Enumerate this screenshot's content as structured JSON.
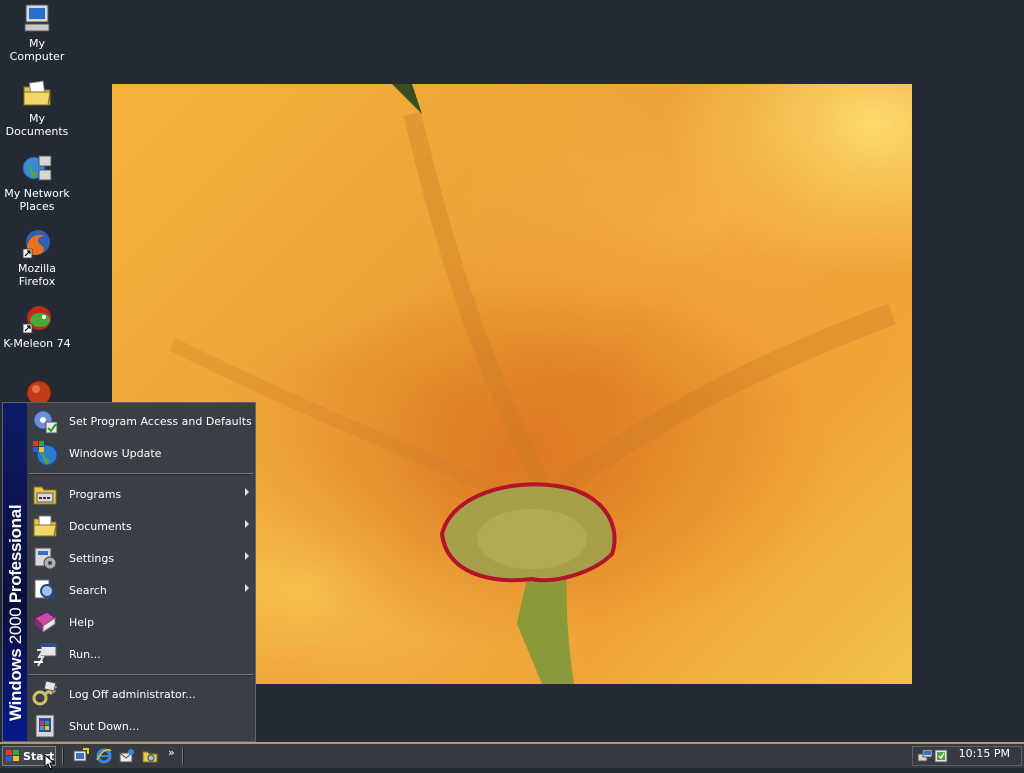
{
  "desktop": {
    "icons": [
      {
        "label": "My Computer"
      },
      {
        "label": "My Documents"
      },
      {
        "label": "My Network Places"
      },
      {
        "label": "Mozilla Firefox"
      },
      {
        "label": "K-Meleon 74"
      }
    ]
  },
  "start_menu": {
    "band_bold": "Windows",
    "band_thin": "2000",
    "band_edition": "Professional",
    "items": [
      {
        "label": "Set Program Access and Defaults",
        "icon": "program-access-icon"
      },
      {
        "label": "Windows Update",
        "icon": "windows-update-icon"
      },
      {
        "label": "Programs",
        "icon": "programs-folder-icon",
        "submenu": true
      },
      {
        "label": "Documents",
        "icon": "documents-folder-icon",
        "submenu": true
      },
      {
        "label": "Settings",
        "icon": "settings-icon",
        "submenu": true
      },
      {
        "label": "Search",
        "icon": "search-icon",
        "submenu": true
      },
      {
        "label": "Help",
        "icon": "help-book-icon"
      },
      {
        "label": "Run...",
        "icon": "run-icon"
      },
      {
        "label": "Log Off administrator...",
        "icon": "log-off-icon"
      },
      {
        "label": "Shut Down...",
        "icon": "shut-down-icon"
      }
    ]
  },
  "taskbar": {
    "start_label": "Start",
    "overflow_chevron": "»",
    "clock": "10:15 PM"
  },
  "colors": {
    "desktop_bg": "#232a33",
    "menu_bg": "#3a3f46",
    "band_blue": "#0a0f3c",
    "taskbar_border": "#b39a5e"
  }
}
